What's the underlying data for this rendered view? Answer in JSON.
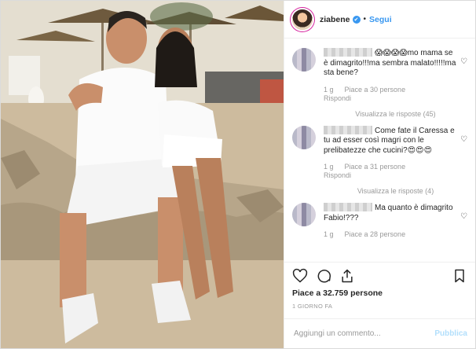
{
  "header": {
    "username": "ziabene",
    "separator": "•",
    "follow_label": "Segui"
  },
  "comments": [
    {
      "text": "😱😱😱😱mo mama se è dimagrito!!!ma sembra malato!!!!!ma sta bene?",
      "time": "1 g",
      "likes": "Piace a 30 persone",
      "reply": "Rispondi",
      "view_replies": "Visualizza le risposte (45)"
    },
    {
      "text": "Come fate il Caressa e tu ad esser così magri con le prelibatezze che cucini?😍😍😍",
      "time": "1 g",
      "likes": "Piace a 31 persone",
      "reply": "Rispondi",
      "view_replies": "Visualizza le risposte (4)"
    },
    {
      "text": "Ma quanto è dimagrito Fabio!???",
      "time": "1 g",
      "likes": "Piace a 28 persone",
      "reply": "",
      "view_replies": ""
    }
  ],
  "likes_label": "Piace a 32.759 persone",
  "date_label": "1 GIORNO FA",
  "add_comment": {
    "placeholder": "Aggiungi un commento...",
    "publish_label": "Pubblica"
  },
  "colors": {
    "accent": "#3897f0",
    "publish_disabled": "#b2dffc",
    "muted_text": "#999999"
  },
  "icons": [
    "heart-icon",
    "comment-icon",
    "share-icon",
    "bookmark-icon",
    "verified-badge-icon"
  ]
}
